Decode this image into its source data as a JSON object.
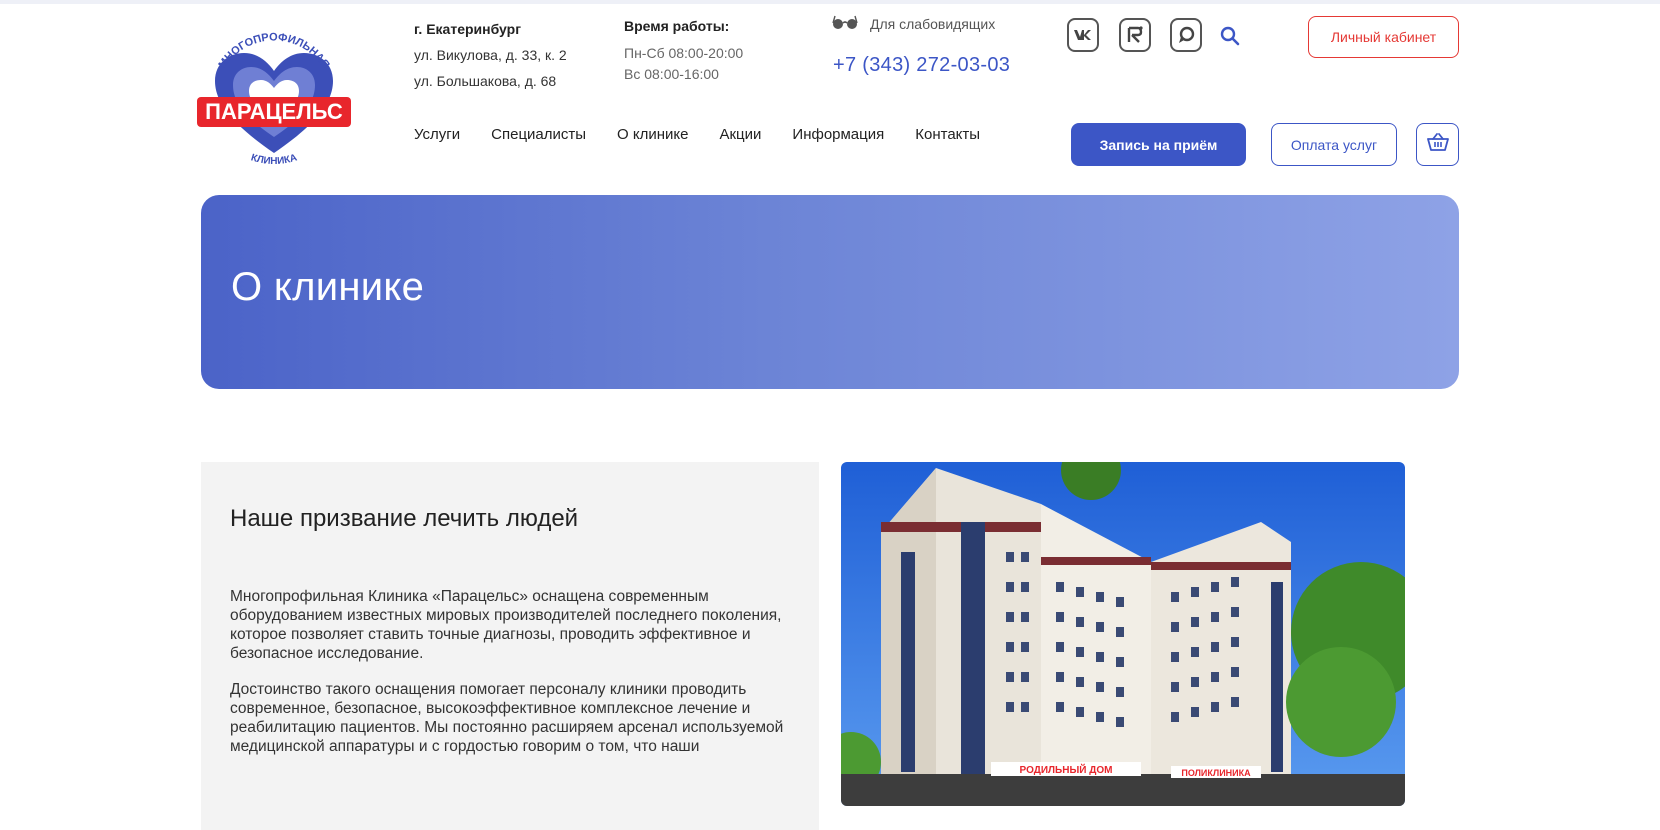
{
  "logo": {
    "top_text": "МНОГОПРОФИЛЬНАЯ",
    "name": "ПАРАЦЕЛЬС",
    "bottom_text": "КЛИНИКА",
    "colors": {
      "blue": "#3c4fb8",
      "red": "#e8262c"
    }
  },
  "contacts": {
    "city": "г. Екатеринбург",
    "address1": "ул. Викулова, д. 33, к. 2",
    "address2": "ул. Большакова, д. 68"
  },
  "hours": {
    "title": "Время работы:",
    "weekdays": "Пн-Сб 08:00-20:00",
    "sunday": "Вс 08:00-16:00"
  },
  "accessibility": {
    "label": "Для слабовидящих",
    "icon": "glasses-icon"
  },
  "phone": "+7 (343) 272-03-03",
  "social": [
    {
      "name": "vk-icon",
      "glyph": "VK"
    },
    {
      "name": "rutube-icon",
      "glyph": "R"
    },
    {
      "name": "chat-icon",
      "glyph": ""
    }
  ],
  "header": {
    "cabinet_label": "Личный кабинет",
    "book_label": "Запись на приём",
    "pay_label": "Оплата услуг"
  },
  "nav": [
    {
      "label": "Услуги"
    },
    {
      "label": "Специалисты"
    },
    {
      "label": "О клинике"
    },
    {
      "label": "Акции"
    },
    {
      "label": "Информация"
    },
    {
      "label": "Контакты"
    }
  ],
  "hero": {
    "title": "О клинике"
  },
  "section": {
    "title": "Наше призвание лечить людей",
    "paragraph1": "Многопрофильная Клиника «Парацельс» оснащена современным оборудованием известных мировых производителей последнего поколения, которое позволяет ставить точные диагнозы, проводить эффективное и безопасное исследование.",
    "paragraph2": "Достоинство такого оснащения помогает персоналу клиники проводить современное, безопасное, высокоэффективное комплексное лечение и реабилитацию пациентов. Мы постоянно расширяем арсенал используемой медицинской аппаратуры и с гордостью говорим о том, что наши"
  },
  "photo": {
    "sign_left": "РОДИЛЬНЫЙ ДОМ",
    "sign_right": "ПОЛИКЛИНИКА"
  },
  "colors": {
    "accent": "#3c56c6",
    "danger": "#e53935"
  }
}
